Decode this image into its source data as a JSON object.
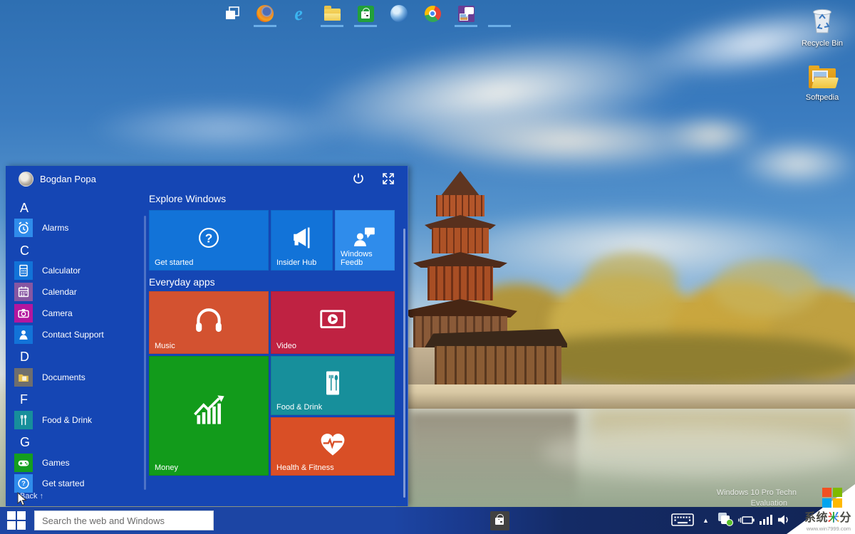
{
  "desktop": {
    "icons": [
      {
        "label": "Recycle Bin"
      },
      {
        "label": "Softpedia"
      }
    ]
  },
  "start_menu": {
    "user_name": "Bogdan Popa",
    "back_label": "Back",
    "back_arrow": "↑",
    "app_list": [
      {
        "type": "letter",
        "label": "A"
      },
      {
        "type": "app",
        "label": "Alarms",
        "color": "#2f8ceb",
        "icon": "alarm-clock-icon"
      },
      {
        "type": "letter",
        "label": "C"
      },
      {
        "type": "app",
        "label": "Calculator",
        "color": "#1273d8",
        "icon": "calculator-icon"
      },
      {
        "type": "app",
        "label": "Calendar",
        "color": "#8656a2",
        "icon": "calendar-icon"
      },
      {
        "type": "app",
        "label": "Camera",
        "color": "#b4169e",
        "icon": "camera-icon"
      },
      {
        "type": "app",
        "label": "Contact Support",
        "color": "#1273d8",
        "icon": "person-icon"
      },
      {
        "type": "letter",
        "label": "D"
      },
      {
        "type": "app",
        "label": "Documents",
        "color": "#6e6e6e",
        "icon": "folder-icon"
      },
      {
        "type": "letter",
        "label": "F"
      },
      {
        "type": "app",
        "label": "Food & Drink",
        "color": "#178f9b",
        "icon": "cutlery-icon"
      },
      {
        "type": "letter",
        "label": "G"
      },
      {
        "type": "app",
        "label": "Games",
        "color": "#149e1f",
        "icon": "gamepad-icon"
      },
      {
        "type": "app",
        "label": "Get started",
        "color": "#2f8ceb",
        "icon": "question-icon"
      }
    ],
    "tile_groups": [
      {
        "title": "Explore Windows",
        "tiles": [
          {
            "label": "Get started",
            "color": "#1273d8",
            "icon": "question-circle-icon"
          },
          {
            "label": "Insider Hub",
            "color": "#1273d8",
            "icon": "megaphone-icon"
          },
          {
            "label": "Windows Feedb",
            "color": "#2f8ceb",
            "icon": "feedback-person-icon"
          }
        ]
      },
      {
        "title": "Everyday apps",
        "tiles": [
          {
            "label": "Music",
            "color": "#d35230",
            "icon": "headphones-icon"
          },
          {
            "label": "Video",
            "color": "#bf2242",
            "icon": "video-player-icon"
          },
          {
            "label": "Money",
            "color": "#129b1b",
            "icon": "finance-chart-icon"
          },
          {
            "label": "Food & Drink",
            "color": "#178f9b",
            "icon": "fork-spoon-icon"
          },
          {
            "label": "Health & Fitness",
            "color": "#d94f26",
            "icon": "heartbeat-icon"
          }
        ]
      }
    ]
  },
  "taskbar": {
    "search_placeholder": "Search the web and Windows",
    "icons": [
      "task-view",
      "firefox",
      "internet-explorer",
      "file-explorer",
      "store",
      "thunderbird",
      "chrome",
      "photos",
      "windows-store"
    ]
  },
  "tray": {
    "icons": [
      "touch-keyboard",
      "show-hidden-icons",
      "status",
      "power",
      "network",
      "volume"
    ]
  },
  "watermark": {
    "line1": "Windows 10 Pro Techn",
    "line2": "Evaluation"
  },
  "corner_logo": {
    "brand_prefix": "系统",
    "brand_mi": "米",
    "brand_suffix": "分",
    "site": "www.win7999.com"
  }
}
